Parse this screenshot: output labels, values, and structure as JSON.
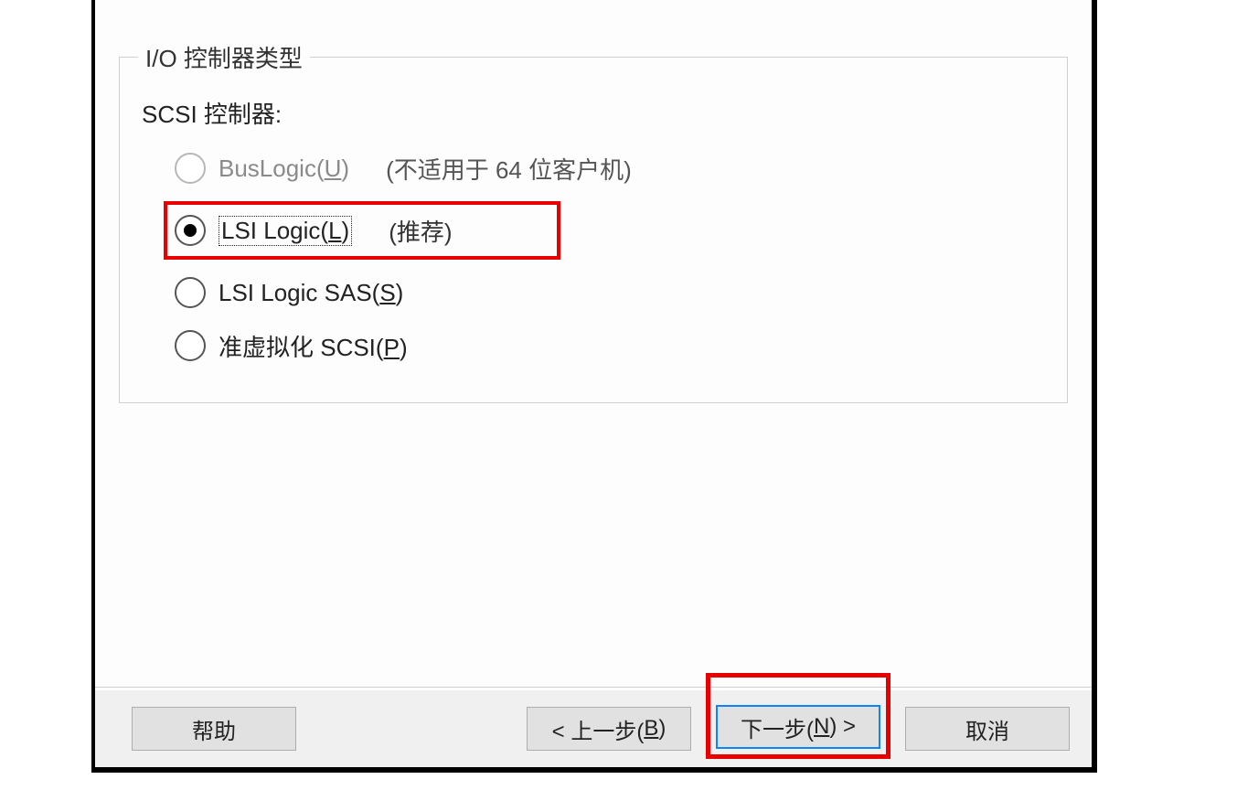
{
  "group": {
    "title": "I/O 控制器类型",
    "sub_label": "SCSI 控制器:"
  },
  "options": [
    {
      "label": "BusLogic",
      "mnemonic": "U",
      "hint": "(不适用于 64 位客户机)",
      "disabled": true,
      "selected": false,
      "highlighted": false,
      "focused": false
    },
    {
      "label": "LSI Logic",
      "mnemonic": "L",
      "hint": "(推荐)",
      "disabled": false,
      "selected": true,
      "highlighted": true,
      "focused": true
    },
    {
      "label": "LSI Logic SAS",
      "mnemonic": "S",
      "hint": "",
      "disabled": false,
      "selected": false,
      "highlighted": false,
      "focused": false
    },
    {
      "label": "准虚拟化 SCSI",
      "mnemonic": "P",
      "hint": "",
      "disabled": false,
      "selected": false,
      "highlighted": false,
      "focused": false
    }
  ],
  "buttons": {
    "help": "帮助",
    "back_pre": "< 上一步(",
    "back_mn": "B",
    "back_post": ")",
    "next_pre": "下一步(",
    "next_mn": "N",
    "next_post": ") >",
    "cancel": "取消"
  }
}
